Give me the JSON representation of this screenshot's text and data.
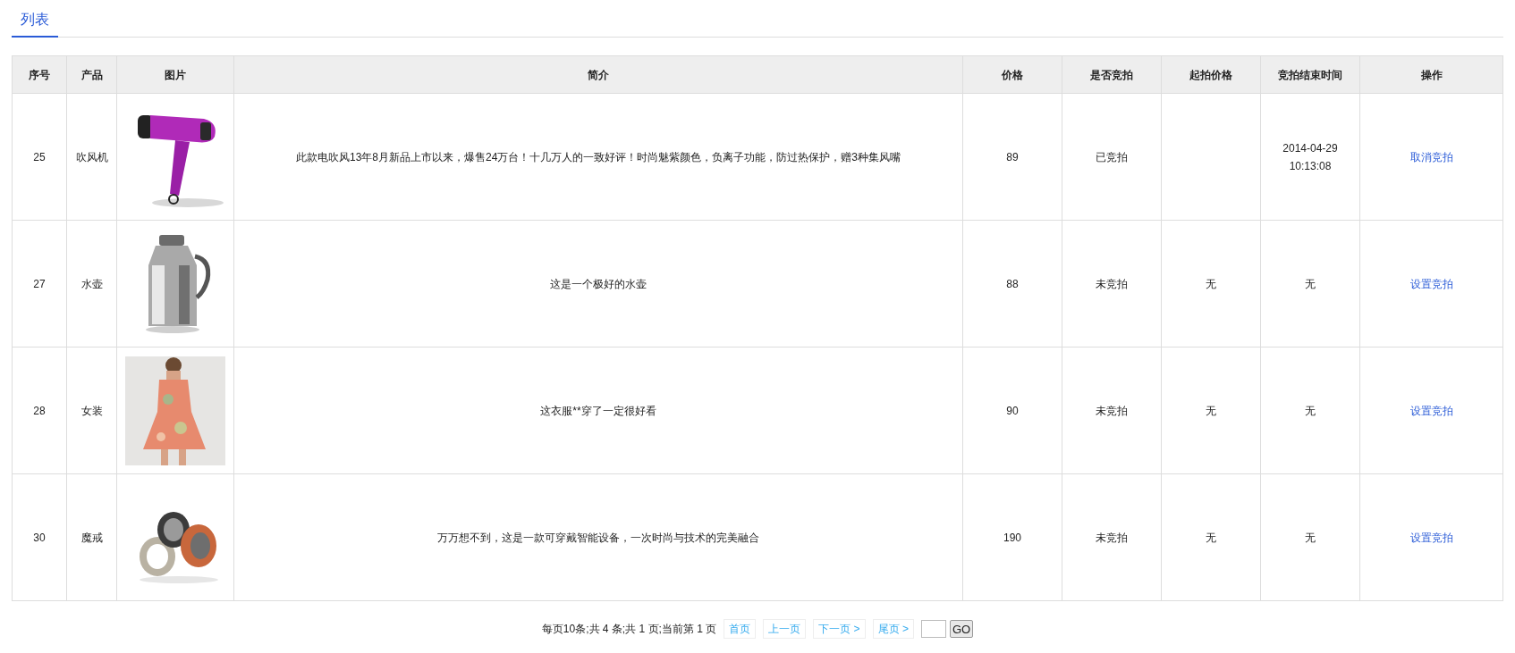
{
  "tabs": [
    {
      "label": "列表",
      "selected": true
    }
  ],
  "table": {
    "columns": [
      "序号",
      "产品",
      "图片",
      "简介",
      "价格",
      "是否竞拍",
      "起拍价格",
      "竞拍结束时间",
      "操作"
    ],
    "rows": [
      {
        "number": "25",
        "product": "吹风机",
        "description": "此款电吹风13年8月新品上市以来，爆售24万台！十几万人的一致好评！时尚魅紫颜色，负离子功能，防过热保护，赠3种集风嘴",
        "price": "89",
        "auction_status": "已竞拍",
        "end_time": "2014-04-29 10:13:08",
        "action": "取消竞拍"
      },
      {
        "number": "27",
        "product": "水壶",
        "description": "这是一个极好的水壶",
        "price": "88",
        "auction_status": "未竞拍",
        "start_price": "无",
        "end_time": "无",
        "action": "设置竞拍"
      },
      {
        "number": "28",
        "product": "女装",
        "description": "这衣服**穿了一定很好看",
        "price": "90",
        "auction_status": "未竞拍",
        "start_price": "无",
        "end_time": "无",
        "action": "设置竞拍"
      },
      {
        "number": "30",
        "product": "魔戒",
        "description": "万万想不到，这是一款可穿戴智能设备，一次时尚与技术的完美融合",
        "price": "190",
        "auction_status": "未竞拍",
        "start_price": "无",
        "end_time": "无",
        "action": "设置竞拍"
      }
    ]
  },
  "pagination": {
    "summary": "每页10条;共 4 条;共 1 页;当前第 1 页",
    "links": [
      "首页",
      "上一页",
      "下一页 >",
      "尾页 >"
    ],
    "go_button": "GO"
  }
}
